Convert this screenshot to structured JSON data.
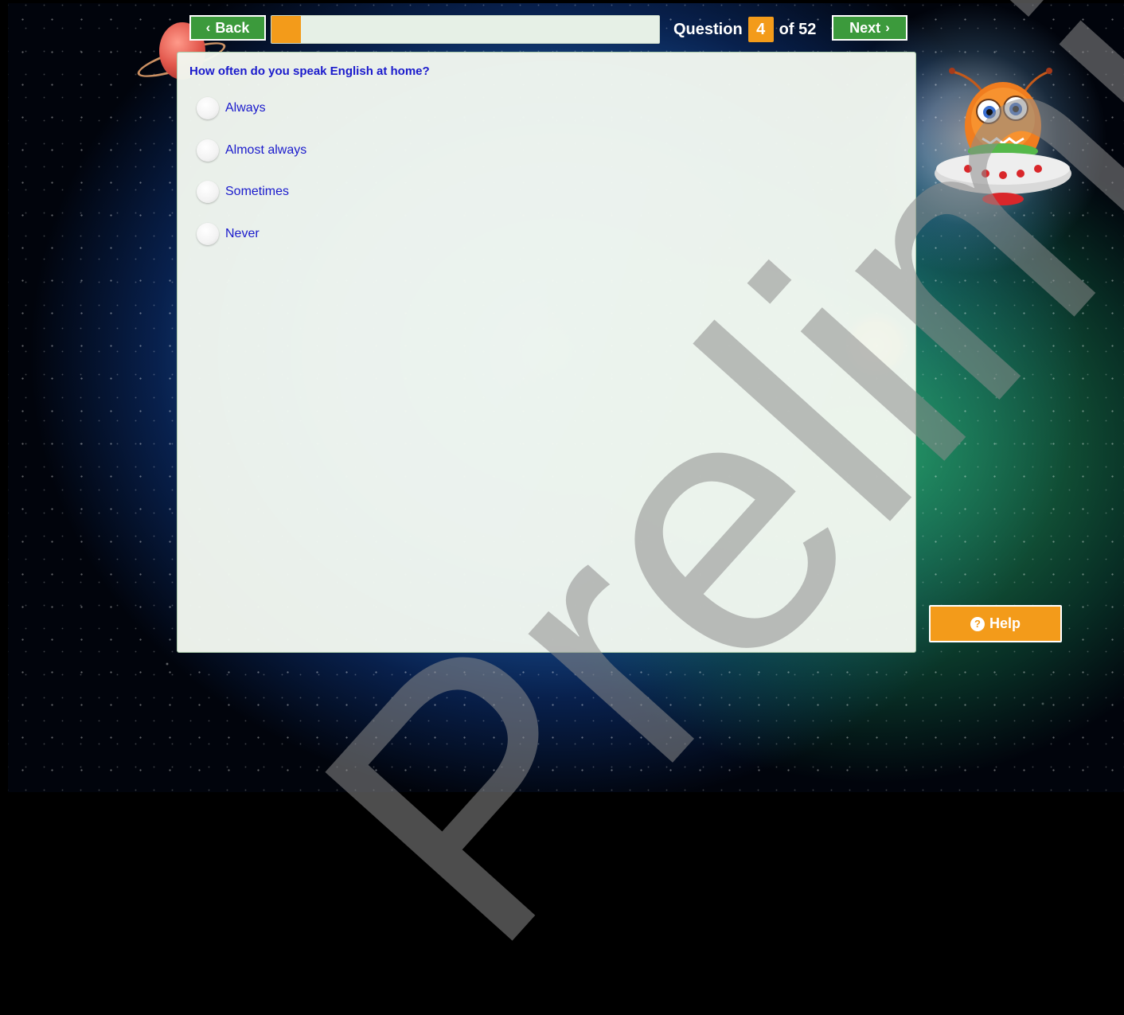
{
  "nav": {
    "back_label": "Back",
    "next_label": "Next",
    "question_word": "Question",
    "current": "4",
    "of_text": "of 52",
    "progress_fraction": 0.075
  },
  "question": {
    "text": "How often do you speak English at home?",
    "options": [
      "Always",
      "Almost always",
      "Sometimes",
      "Never"
    ]
  },
  "help": {
    "label": "Help",
    "icon": "question-circle-icon"
  },
  "watermark": "Preliminary",
  "colors": {
    "accent_orange": "#f39b1a",
    "nav_green": "#3c9a3c",
    "text_blue": "#1a1acc"
  }
}
